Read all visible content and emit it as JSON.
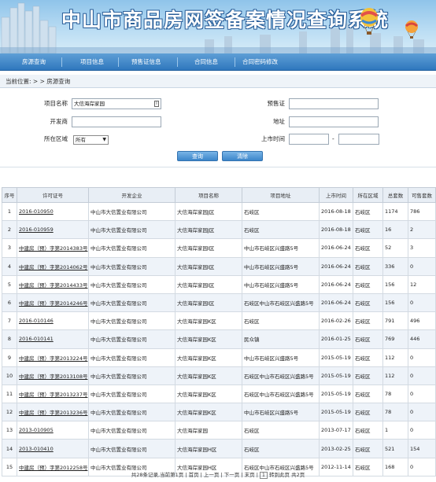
{
  "header": {
    "title": "中山市商品房网签备案情况查询系统"
  },
  "nav": {
    "items": [
      "房源查询",
      "项目信息",
      "预售证信息",
      "合同信息",
      "合同密码修改"
    ]
  },
  "breadcrumb": {
    "text": "当前位置: > > 房源查询"
  },
  "search": {
    "project_name_label": "项目名称",
    "project_name_value": "大信海岸家园",
    "developer_label": "开发商",
    "developer_value": "",
    "district_label": "所在区域",
    "district_value": "所有",
    "presale_label": "预售证",
    "presale_value": "",
    "address_label": "地址",
    "address_value": "",
    "listing_time_label": "上市时间",
    "date_from": "",
    "date_to": "",
    "date_sep": "-",
    "query_button": "查询",
    "clear_button": "清除"
  },
  "table": {
    "columns": [
      "序号",
      "许可证号",
      "开发企业",
      "项目名称",
      "项目地址",
      "上市时间",
      "所在区域",
      "总套数",
      "可售套数"
    ],
    "rows": [
      [
        "1",
        "2016-010950",
        "中山市大信置业有限公司",
        "大信海岸家园J区",
        "石岐区",
        "2016-08-18",
        "石岐区",
        "1174",
        "786"
      ],
      [
        "2",
        "2016-010959",
        "中山市大信置业有限公司",
        "大信海岸家园J区",
        "石岐区",
        "2016-08-18",
        "石岐区",
        "16",
        "2"
      ],
      [
        "3",
        "中建房（预）字第2014383号",
        "中山市大信置业有限公司",
        "大信海岸家园I区",
        "中山市石岐区兴盛路5号",
        "2016-06-24",
        "石岐区",
        "52",
        "3"
      ],
      [
        "4",
        "中建房（预）字第2014062号",
        "中山市大信置业有限公司",
        "大信海岸家园I区",
        "中山市石岐区兴盛路5号",
        "2016-06-24",
        "石岐区",
        "336",
        "0"
      ],
      [
        "5",
        "中建房（预）字第2014433号",
        "中山市大信置业有限公司",
        "大信海岸家园I区",
        "中山市石岐区兴盛路5号",
        "2016-06-24",
        "石岐区",
        "156",
        "12"
      ],
      [
        "6",
        "中建房（预）字第2014246号",
        "中山市大信置业有限公司",
        "大信海岸家园I区",
        "石岐区中山市石岐区兴盛路5号",
        "2016-06-24",
        "石岐区",
        "156",
        "0"
      ],
      [
        "7",
        "2016-010146",
        "中山市大信置业有限公司",
        "大信海岸家园K区",
        "石岐区",
        "2016-02-26",
        "石岐区",
        "791",
        "496"
      ],
      [
        "8",
        "2016-010141",
        "中山市大信置业有限公司",
        "大信海岸家园K区",
        "民众镇",
        "2016-01-25",
        "石岐区",
        "769",
        "446"
      ],
      [
        "9",
        "中建房（预）字第2013224号",
        "中山市大信置业有限公司",
        "大信海岸家园K区",
        "中山市石岐区兴盛路5号",
        "2015-05-19",
        "石岐区",
        "112",
        "0"
      ],
      [
        "10",
        "中建房（预）字第2013108号",
        "中山市大信置业有限公司",
        "大信海岸家园K区",
        "石岐区中山市石岐区兴盛路5号",
        "2015-05-19",
        "石岐区",
        "112",
        "0"
      ],
      [
        "11",
        "中建房（预）字第2013237号",
        "中山市大信置业有限公司",
        "大信海岸家园K区",
        "石岐区中山市石岐区兴盛路5号",
        "2015-05-19",
        "石岐区",
        "78",
        "0"
      ],
      [
        "12",
        "中建房（预）字第2013236号",
        "中山市大信置业有限公司",
        "大信海岸家园K区",
        "中山市石岐区兴盛路5号",
        "2015-05-19",
        "石岐区",
        "78",
        "0"
      ],
      [
        "13",
        "2013-010905",
        "中山市大信置业有限公司",
        "大信海岸家园",
        "石岐区",
        "2013-07-17",
        "石岐区",
        "1",
        "0"
      ],
      [
        "14",
        "2013-010410",
        "中山市大信置业有限公司",
        "大信海岸家园H区",
        "石岐区",
        "2013-02-25",
        "石岐区",
        "521",
        "154"
      ],
      [
        "15",
        "中建房（预）字第2012258号",
        "中山市大信置业有限公司",
        "大信海岸家园H区",
        "石岐区中山市石岐区兴盛路5号",
        "2012-11-14",
        "石岐区",
        "168",
        "0"
      ]
    ]
  },
  "pager": {
    "summary": "共28条记录,当前第1页",
    "first": "首页",
    "prev": "上一页",
    "next": "下一页",
    "last": "末页",
    "page_value": "1",
    "goto": "转到此页",
    "total_pages": "共2页"
  }
}
